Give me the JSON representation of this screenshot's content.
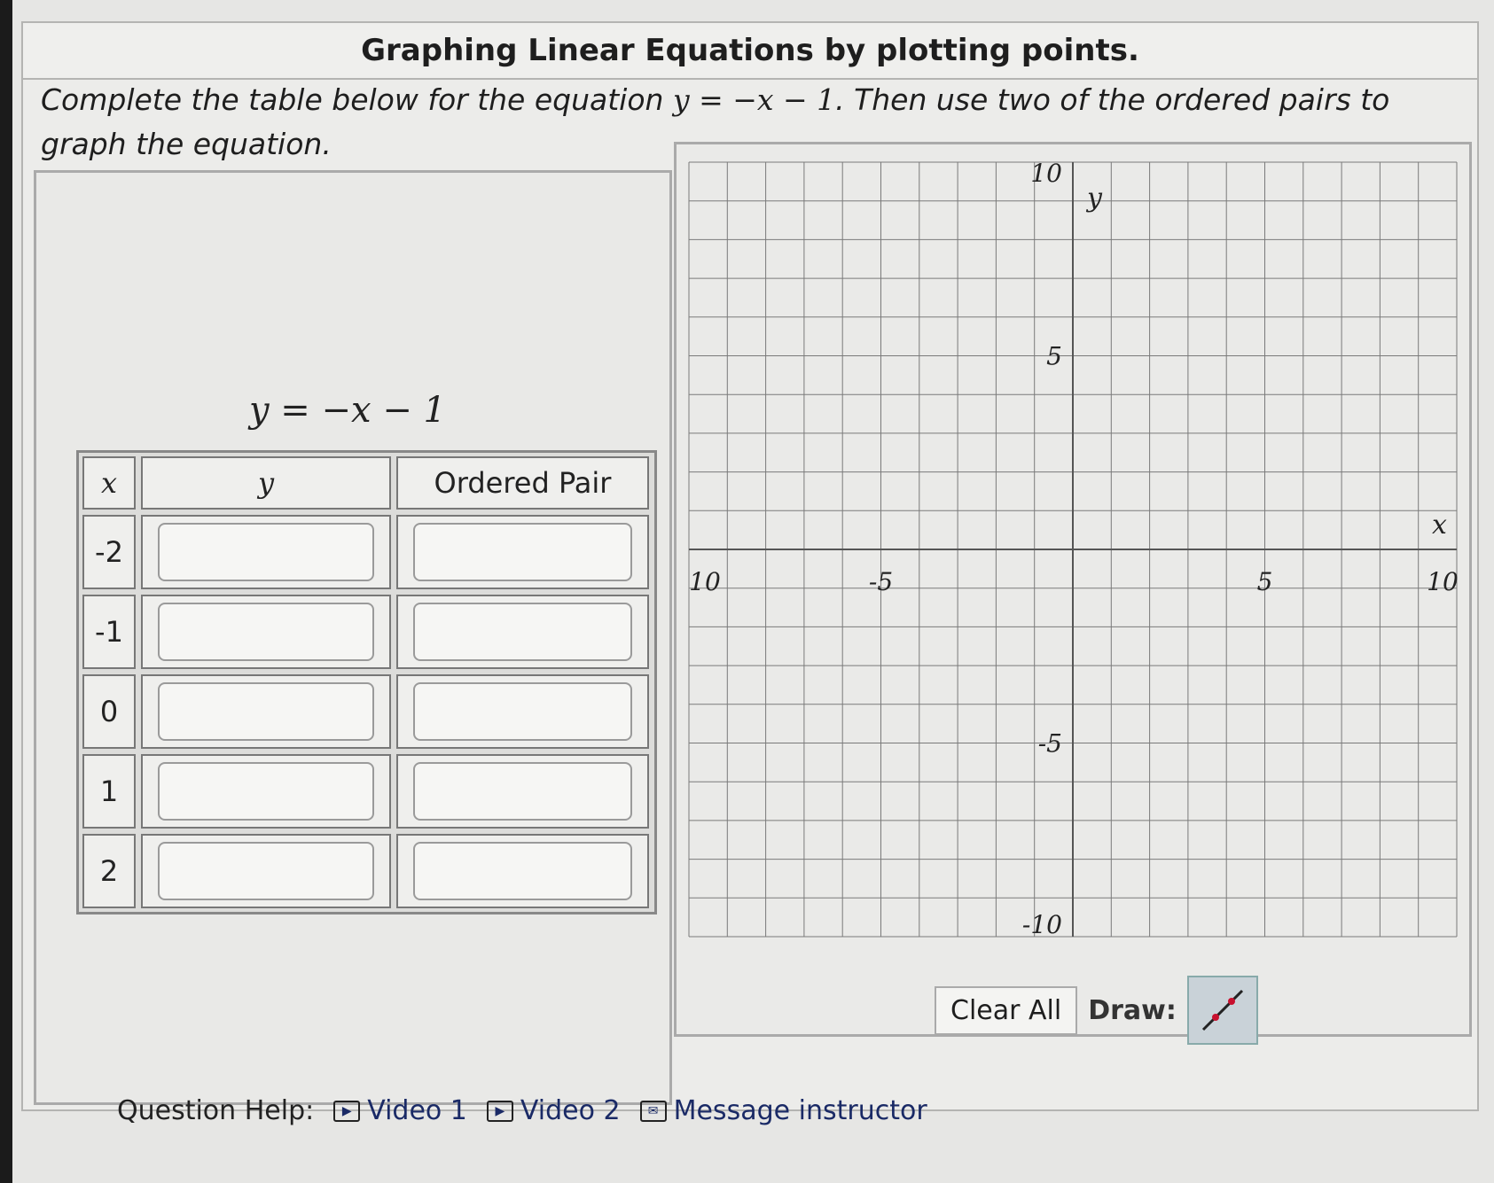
{
  "title": "Graphing Linear Equations by plotting points.",
  "question": {
    "prefix": "Complete the table below for the equation ",
    "equation": "y = −x − 1",
    "suffix": ". Then use two of the ordered pairs to graph the equation."
  },
  "equation_display": "y = −x − 1",
  "table": {
    "headers": [
      "x",
      "y",
      "Ordered Pair"
    ],
    "rows": [
      {
        "x": "-2",
        "y": "",
        "pair": ""
      },
      {
        "x": "-1",
        "y": "",
        "pair": ""
      },
      {
        "x": "0",
        "y": "",
        "pair": ""
      },
      {
        "x": "1",
        "y": "",
        "pair": ""
      },
      {
        "x": "2",
        "y": "",
        "pair": ""
      }
    ]
  },
  "graph": {
    "xmin": -10,
    "xmax": 10,
    "ymin": -10,
    "ymax": 10,
    "grid_step": 1,
    "x_axis_label": "x",
    "y_axis_label": "y",
    "x_tick_labels": [
      {
        "value": -10,
        "text": "10"
      },
      {
        "value": -5,
        "text": "-5"
      },
      {
        "value": 5,
        "text": "5"
      },
      {
        "value": 10,
        "text": "10"
      }
    ],
    "y_tick_labels": [
      {
        "value": 10,
        "text": "10"
      },
      {
        "value": 5,
        "text": "5"
      },
      {
        "value": -5,
        "text": "-5"
      },
      {
        "value": -10,
        "text": "-10"
      }
    ],
    "grid_color": "#7a7a7a",
    "axis_color": "#555555"
  },
  "controls": {
    "clear_label": "Clear All",
    "draw_label": "Draw:",
    "draw_tool_icon": "line-tool-icon",
    "draw_tool_color": "#c8102e"
  },
  "help": {
    "label": "Question Help:",
    "video1": "Video 1",
    "video2": "Video 2",
    "message": "Message instructor"
  }
}
